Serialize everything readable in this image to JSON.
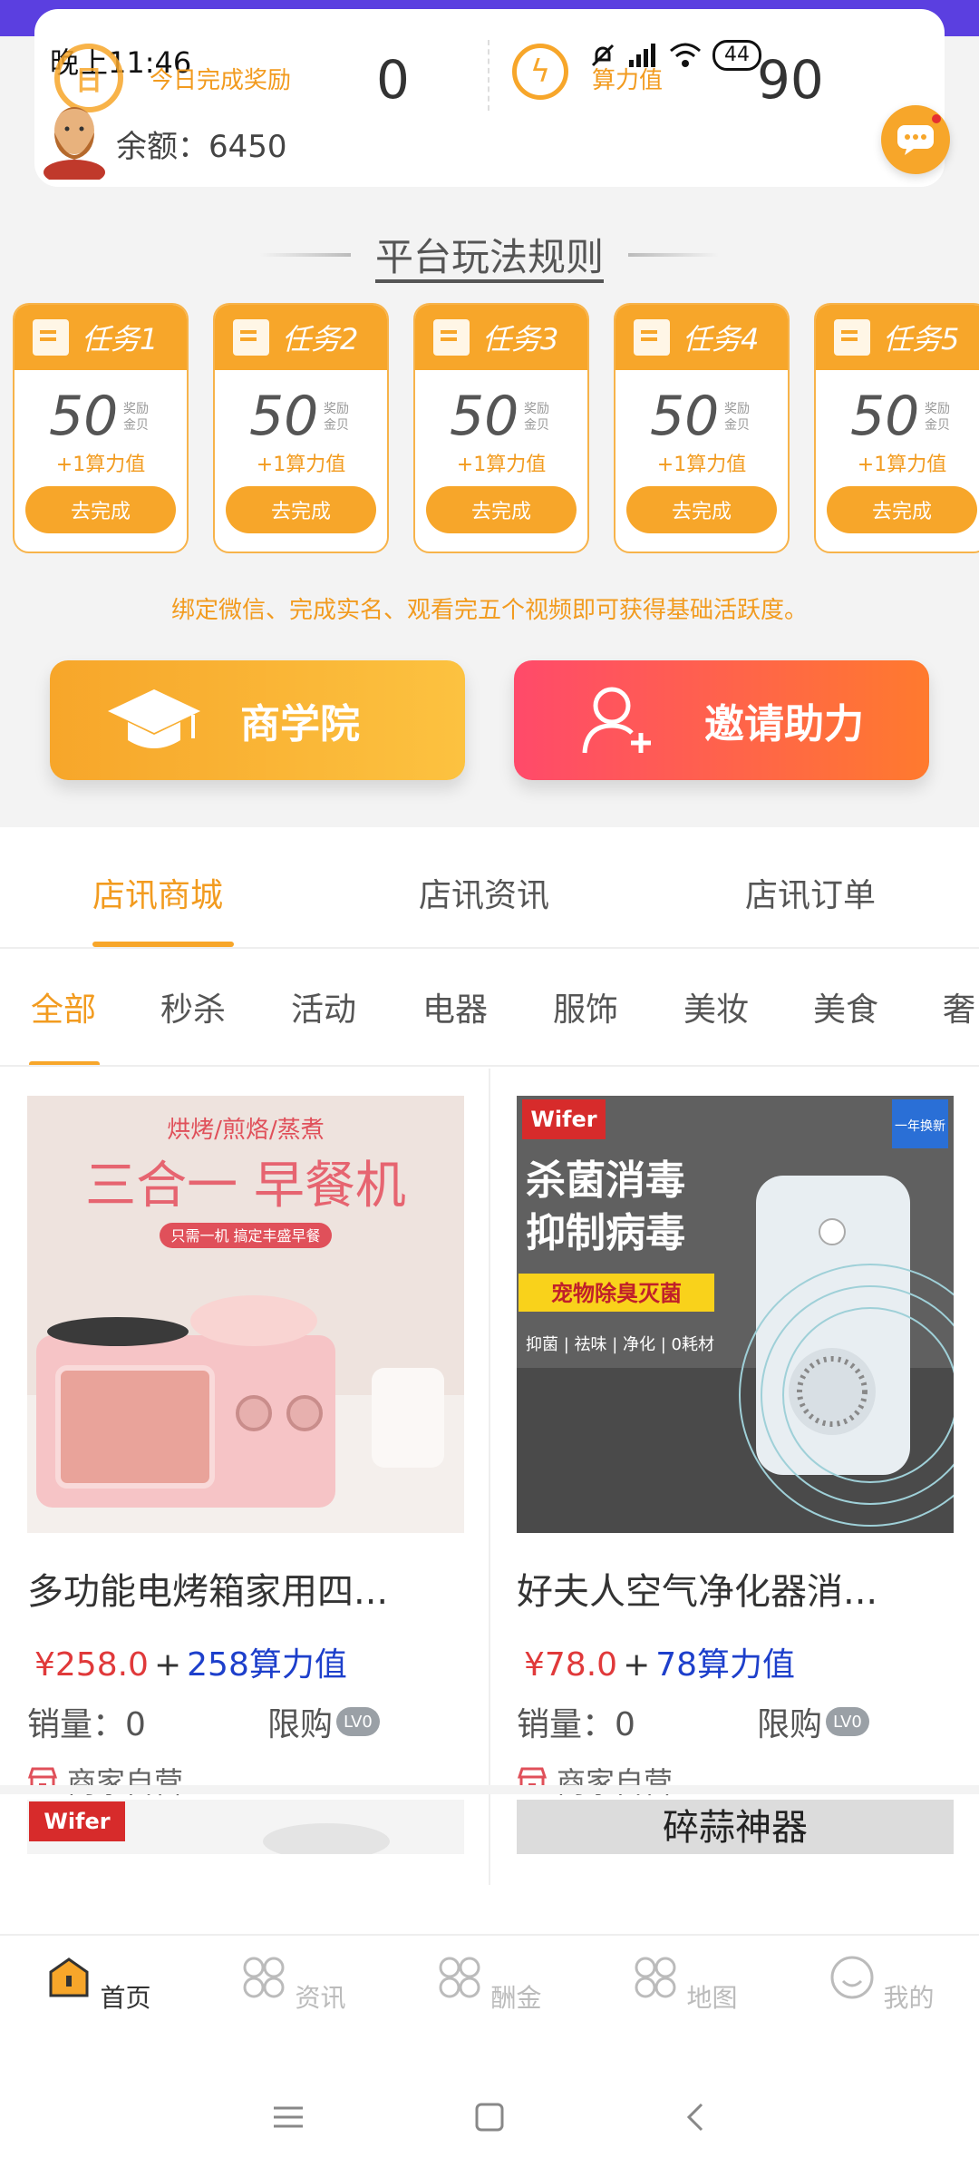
{
  "status_bar": {
    "time": "晚上11:46",
    "battery": "44"
  },
  "summary": {
    "today_reward_label": "今日完成奖励",
    "today_reward_value": "0",
    "power_label": "算力值",
    "power_value": "90",
    "balance": "余额：6450"
  },
  "rules_title": "平台玩法规则",
  "tasks": [
    {
      "title": "任务1",
      "amount": "50",
      "unit": "奖励金贝",
      "bonus": "+1算力值",
      "button": "去完成"
    },
    {
      "title": "任务2",
      "amount": "50",
      "unit": "奖励金贝",
      "bonus": "+1算力值",
      "button": "去完成"
    },
    {
      "title": "任务3",
      "amount": "50",
      "unit": "奖励金贝",
      "bonus": "+1算力值",
      "button": "去完成"
    },
    {
      "title": "任务4",
      "amount": "50",
      "unit": "奖励金贝",
      "bonus": "+1算力值",
      "button": "去完成"
    },
    {
      "title": "任务5",
      "amount": "50",
      "unit": "奖励金贝",
      "bonus": "+1算力值",
      "button": "去完成"
    }
  ],
  "tip": "绑定微信、完成实名、观看完五个视频即可获得基础活跃度。",
  "actions": {
    "school": "商学院",
    "invite": "邀请助力"
  },
  "main_tabs": [
    "店讯商城",
    "店讯资讯",
    "店讯订单"
  ],
  "categories": [
    "全部",
    "秒杀",
    "活动",
    "电器",
    "服饰",
    "美妆",
    "美食",
    "奢"
  ],
  "products": [
    {
      "name": "多功能电烤箱家用四...",
      "price": "¥258.0",
      "plus": "+",
      "power": "258算力值",
      "sales": "销量：0",
      "limit": "限购",
      "level": "LV0",
      "shop": "商家自营",
      "img_top": "烘烤/煎烙/蒸煮",
      "img_title": "三合一 早餐机",
      "img_tag": "只需一机 搞定丰盛早餐"
    },
    {
      "name": "好夫人空气净化器消...",
      "price": "¥78.0",
      "plus": "+",
      "power": "78算力值",
      "sales": "销量：0",
      "limit": "限购",
      "level": "LV0",
      "shop": "商家自营",
      "img_brand": "Wifer",
      "img_corner": "一年换新",
      "img_line1": "杀菌消毒",
      "img_line2": "抑制病毒",
      "img_tag": "宠物除臭灭菌",
      "img_sub": "抑菌 | 祛味 | 净化 | 0耗材"
    }
  ],
  "peek": {
    "left_brand": "Wifer",
    "right_text": "碎蒜神器"
  },
  "bottom_nav": [
    "首页",
    "资讯",
    "酬金",
    "地图",
    "我的"
  ],
  "colors": {
    "accent": "#f7a62a",
    "price_red": "#e0393a",
    "power_blue": "#1d3fcb",
    "invite": "#ff4a6a"
  }
}
